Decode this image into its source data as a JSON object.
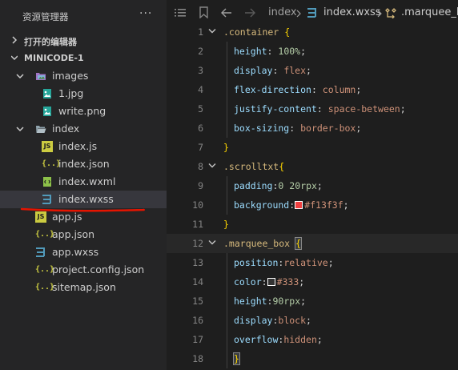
{
  "explorer": {
    "title": "资源管理器",
    "more": "···",
    "open_editors_label": "打开的编辑器",
    "project_label": "MINICODE-1"
  },
  "tree": [
    {
      "name": "images",
      "type": "folder",
      "icon": "image-folder-icon",
      "expanded": true
    },
    {
      "name": "1.jpg",
      "type": "file",
      "icon": "image-file-icon"
    },
    {
      "name": "write.png",
      "type": "file",
      "icon": "image-file-icon"
    },
    {
      "name": "index",
      "type": "folder",
      "icon": "folder-open-icon",
      "expanded": true
    },
    {
      "name": "index.js",
      "type": "file",
      "icon": "js-file-icon",
      "badge": "JS"
    },
    {
      "name": "index.json",
      "type": "file",
      "icon": "json-file-icon",
      "badge": "{..}"
    },
    {
      "name": "index.wxml",
      "type": "file",
      "icon": "wxml-file-icon"
    },
    {
      "name": "index.wxss",
      "type": "file",
      "icon": "css-file-icon",
      "selected": true
    },
    {
      "name": "app.js",
      "type": "file",
      "icon": "js-file-icon",
      "badge": "JS"
    },
    {
      "name": "app.json",
      "type": "file",
      "icon": "json-file-icon",
      "badge": "{..}"
    },
    {
      "name": "app.wxss",
      "type": "file",
      "icon": "css-file-icon"
    },
    {
      "name": "project.config.json",
      "type": "file",
      "icon": "json-file-icon",
      "badge": "{..}"
    },
    {
      "name": "sitemap.json",
      "type": "file",
      "icon": "json-file-icon",
      "badge": "{..}"
    }
  ],
  "breadcrumb": {
    "folder": "index",
    "file": "index.wxss",
    "symbol": ".marquee_bo"
  },
  "colors": {
    "accent_underline": "#e51400",
    "swatch_f13f3f": "#f13f3f",
    "swatch_333": "#333333"
  },
  "code_lines": [
    {
      "n": "1",
      "fold": true,
      "tokens": [
        {
          "t": ".container",
          "c": "sel"
        },
        {
          "t": " "
        },
        {
          "t": "{",
          "c": "brace"
        }
      ]
    },
    {
      "n": "2",
      "indent": true,
      "tokens": [
        {
          "t": "height",
          "c": "prop"
        },
        {
          "t": ": "
        },
        {
          "t": "100%",
          "c": "num"
        },
        {
          "t": ";"
        }
      ]
    },
    {
      "n": "3",
      "indent": true,
      "tokens": [
        {
          "t": "display",
          "c": "prop"
        },
        {
          "t": ": "
        },
        {
          "t": "flex",
          "c": "val"
        },
        {
          "t": ";"
        }
      ]
    },
    {
      "n": "4",
      "indent": true,
      "tokens": [
        {
          "t": "flex-direction",
          "c": "prop"
        },
        {
          "t": ": "
        },
        {
          "t": "column",
          "c": "val"
        },
        {
          "t": ";"
        }
      ]
    },
    {
      "n": "5",
      "indent": true,
      "tokens": [
        {
          "t": "justify-content",
          "c": "prop"
        },
        {
          "t": ": "
        },
        {
          "t": "space-between",
          "c": "val"
        },
        {
          "t": ";"
        }
      ]
    },
    {
      "n": "6",
      "indent": true,
      "tokens": [
        {
          "t": "box-sizing",
          "c": "prop"
        },
        {
          "t": ": "
        },
        {
          "t": "border-box",
          "c": "val"
        },
        {
          "t": ";"
        }
      ]
    },
    {
      "n": "7",
      "tokens": [
        {
          "t": "}",
          "c": "brace"
        }
      ]
    },
    {
      "n": "8",
      "fold": true,
      "tokens": [
        {
          "t": ".scrolltxt",
          "c": "sel"
        },
        {
          "t": "{",
          "c": "brace"
        }
      ]
    },
    {
      "n": "9",
      "indent": true,
      "tokens": [
        {
          "t": "padding",
          "c": "prop"
        },
        {
          "t": ":"
        },
        {
          "t": "0",
          "c": "num"
        },
        {
          "t": " "
        },
        {
          "t": "20",
          "c": "num"
        },
        {
          "t": "rpx",
          "c": "unit"
        },
        {
          "t": ";"
        }
      ]
    },
    {
      "n": "10",
      "indent": true,
      "tokens": [
        {
          "t": "background",
          "c": "prop"
        },
        {
          "t": ":"
        },
        {
          "swatch": "#f13f3f"
        },
        {
          "t": "#f13f3f",
          "c": "val"
        },
        {
          "t": ";"
        }
      ]
    },
    {
      "n": "11",
      "tokens": [
        {
          "t": "}",
          "c": "brace"
        }
      ]
    },
    {
      "n": "12",
      "fold": true,
      "active": true,
      "tokens": [
        {
          "t": ".marquee_box",
          "c": "sel"
        },
        {
          "t": " "
        },
        {
          "t": "{",
          "c": "brace",
          "match": true
        }
      ]
    },
    {
      "n": "13",
      "indent": true,
      "tokens": [
        {
          "t": "position",
          "c": "prop"
        },
        {
          "t": ":"
        },
        {
          "t": "relative",
          "c": "val"
        },
        {
          "t": ";"
        }
      ]
    },
    {
      "n": "14",
      "indent": true,
      "tokens": [
        {
          "t": "color",
          "c": "prop"
        },
        {
          "t": ":"
        },
        {
          "swatch": "#333333"
        },
        {
          "t": "#333",
          "c": "val"
        },
        {
          "t": ";"
        }
      ]
    },
    {
      "n": "15",
      "indent": true,
      "tokens": [
        {
          "t": "height",
          "c": "prop"
        },
        {
          "t": ":"
        },
        {
          "t": "90",
          "c": "num"
        },
        {
          "t": "rpx",
          "c": "unit"
        },
        {
          "t": ";"
        }
      ]
    },
    {
      "n": "16",
      "indent": true,
      "tokens": [
        {
          "t": "display",
          "c": "prop"
        },
        {
          "t": ":"
        },
        {
          "t": "block",
          "c": "val"
        },
        {
          "t": ";"
        }
      ]
    },
    {
      "n": "17",
      "indent": true,
      "tokens": [
        {
          "t": "overflow",
          "c": "prop"
        },
        {
          "t": ":"
        },
        {
          "t": "hidden",
          "c": "val"
        },
        {
          "t": ";"
        }
      ]
    },
    {
      "n": "18",
      "indent": true,
      "tokens": [
        {
          "t": "}",
          "c": "brace",
          "match": true
        }
      ]
    }
  ]
}
